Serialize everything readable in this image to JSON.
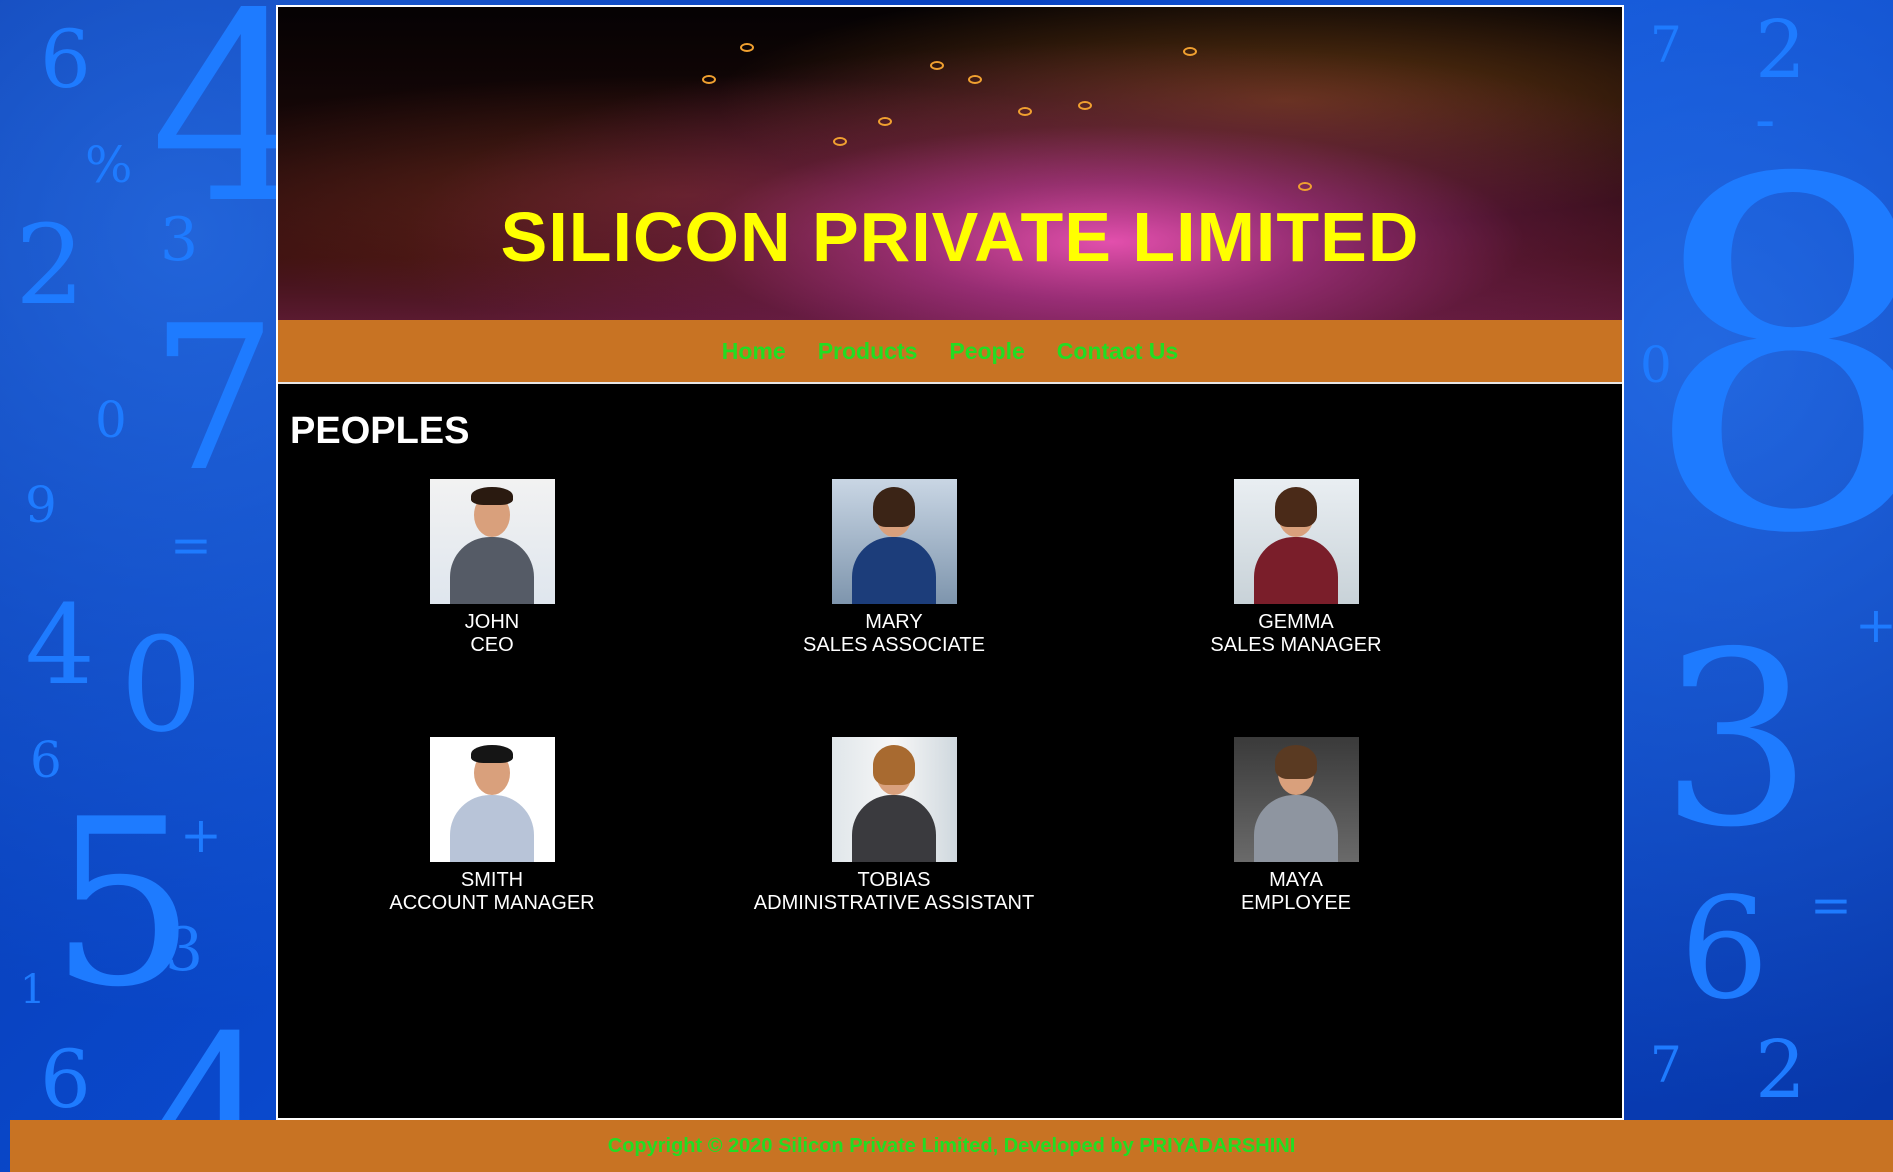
{
  "header": {
    "title": "SILICON PRIVATE LIMITED"
  },
  "nav": {
    "items": [
      {
        "label": "Home"
      },
      {
        "label": "Products"
      },
      {
        "label": "People"
      },
      {
        "label": "Contact Us"
      }
    ]
  },
  "main": {
    "section_title": "PEOPLES",
    "people": [
      {
        "name": "JOHN",
        "role": "CEO"
      },
      {
        "name": "MARY",
        "role": "SALES ASSOCIATE"
      },
      {
        "name": "GEMMA",
        "role": "SALES MANAGER"
      },
      {
        "name": "SMITH",
        "role": "ACCOUNT MANAGER"
      },
      {
        "name": "TOBIAS",
        "role": "ADMINISTRATIVE ASSISTANT"
      },
      {
        "name": "MAYA",
        "role": "EMPLOYEE"
      }
    ]
  },
  "footer": {
    "text": "Copyright © 2020 Silicon Private Limited, Developed by PRIYADARSHINI"
  },
  "colors": {
    "title": "#ffff00",
    "nav_bg": "#c87323",
    "nav_link": "#22dd22",
    "content_bg": "#000000",
    "page_bg": "#0a3fb5"
  }
}
